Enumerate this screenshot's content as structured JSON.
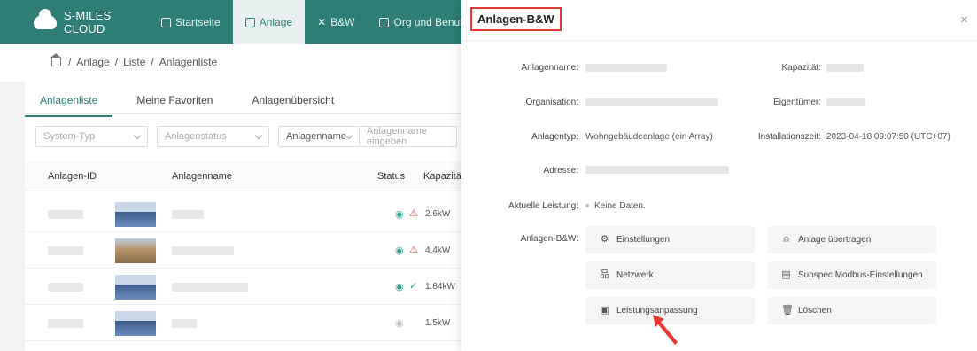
{
  "app": {
    "logo_text": "S-MILES CLOUD",
    "nav": [
      {
        "label": "Startseite"
      },
      {
        "label": "Anlage"
      },
      {
        "label": "B&W"
      },
      {
        "label": "Org und Benutzer"
      }
    ]
  },
  "breadcrumb": [
    "Anlage",
    "Liste",
    "Anlagenliste"
  ],
  "tabs": [
    "Anlagenliste",
    "Meine Favoriten",
    "Anlagenübersicht"
  ],
  "filters": {
    "system_type": "System-Typ",
    "plant_status": "Anlagenstatus",
    "name_field": "Anlagenname",
    "name_placeholder": "Anlagenname eingeben"
  },
  "table": {
    "columns": [
      "Anlagen-ID",
      "Anlagenname",
      "Status",
      "Kapazität"
    ],
    "rows": [
      {
        "capacity": "2.6kW",
        "status": "alarm"
      },
      {
        "capacity": "4.4kW",
        "status": "alarm"
      },
      {
        "capacity": "1.84kW",
        "status": "ok"
      },
      {
        "capacity": "1.5kW",
        "status": "offline"
      }
    ]
  },
  "modal": {
    "title": "Anlagen-B&W",
    "close": "×",
    "fields": {
      "name_label": "Anlagenname:",
      "capacity_label": "Kapazität:",
      "org_label": "Organisation:",
      "owner_label": "Eigentümer:",
      "type_label": "Anlagentyp:",
      "type_value": "Wohngebäudeanlage (ein Array)",
      "install_label": "Installationszeit:",
      "install_value": "2023-04-18 09:07:50 (UTC+07)",
      "address_label": "Adresse:",
      "power_label": "Aktuelle Leistung:",
      "power_value": "Keine Daten.",
      "ops_label": "Anlagen-B&W:"
    },
    "actions": [
      {
        "label": "Einstellungen",
        "icon": "gear-icon"
      },
      {
        "label": "Anlage übertragen",
        "icon": "user-icon"
      },
      {
        "label": "Netzwerk",
        "icon": "network-icon"
      },
      {
        "label": "Sunspec Modbus-Einstellungen",
        "icon": "document-icon"
      },
      {
        "label": "Leistungsanpassung",
        "icon": "power-adjust-icon"
      },
      {
        "label": "Löschen",
        "icon": "trash-icon"
      }
    ],
    "highlight_color": "#e53935"
  },
  "colors": {
    "brand": "#2e7d76",
    "alarm": "#d9534f",
    "ok": "#3aa58f"
  }
}
